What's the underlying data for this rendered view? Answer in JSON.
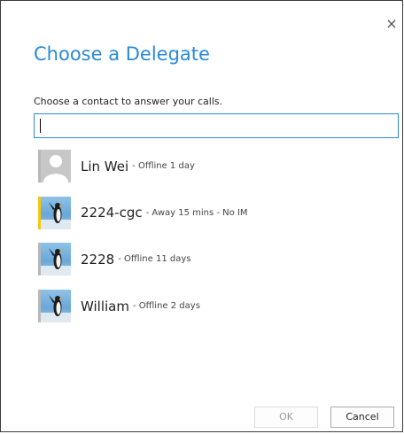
{
  "dialog": {
    "title": "Choose a Delegate",
    "close_icon": "×",
    "prompt": "Choose a contact to answer your calls.",
    "search": {
      "value": "",
      "placeholder": ""
    },
    "contacts": [
      {
        "name": "Lin Wei",
        "status": "- Offline 1 day",
        "avatar": "generic-person-icon",
        "presence": "offline"
      },
      {
        "name": "2224-cgc",
        "status": "- Away 15 mins - No IM",
        "avatar": "penguin-photo",
        "presence": "away"
      },
      {
        "name": "2228",
        "status": "- Offline 11 days",
        "avatar": "penguin-photo",
        "presence": "offline"
      },
      {
        "name": "William",
        "status": "- Offline 2 days",
        "avatar": "penguin-photo",
        "presence": "offline"
      }
    ],
    "buttons": {
      "ok": "OK",
      "cancel": "Cancel"
    }
  },
  "colors": {
    "accent": "#2a8ad6",
    "away": "#f7c808",
    "offline": "#b8b8b8"
  }
}
